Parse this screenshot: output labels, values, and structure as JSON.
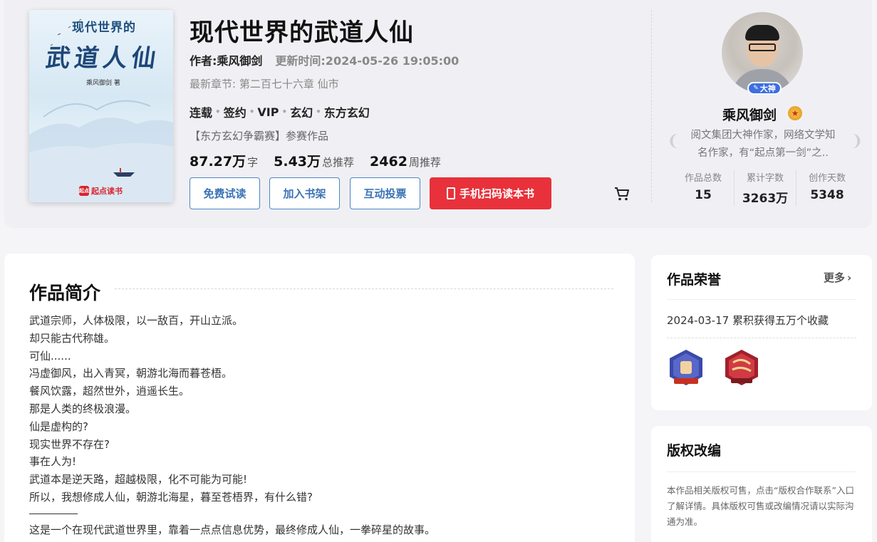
{
  "book": {
    "cover_subtitle": "现代世界的",
    "cover_main": "武道人仙",
    "cover_author": "乘风御剑 著",
    "cover_logo": "起点读书",
    "cover_logo_mark": "起点",
    "title": "现代世界的武道人仙",
    "author_label": "作者:乘风御剑",
    "update_label": "更新时间:2024-05-26 19:05:00",
    "latest_chapter": "最新章节: 第二百七十六章 仙市",
    "tags": [
      "连载",
      "签约",
      "VIP",
      "玄幻",
      "东方玄幻"
    ],
    "tag_separator": "•",
    "contest": "【东方玄幻争霸赛】参赛作品",
    "stats": [
      {
        "num": "87.27万",
        "unit": "字"
      },
      {
        "num": "5.43万",
        "unit": "总推荐"
      },
      {
        "num": "2462",
        "unit": "周推荐"
      }
    ]
  },
  "buttons": {
    "free_read": "免费试读",
    "add_shelf": "加入书架",
    "vote": "互动投票",
    "phone_read": "手机扫码读本书"
  },
  "author": {
    "name": "乘风御剑",
    "badge": "大神",
    "level_icon": "★",
    "desc_line1": "阅文集团大神作家，网络文学知",
    "desc_line2": "名作家，有“起点第一剑”之..",
    "laurel_left": "❨",
    "laurel_right": "❩",
    "stats": [
      {
        "label": "作品总数",
        "value": "15"
      },
      {
        "label": "累计字数",
        "value": "3263万"
      },
      {
        "label": "创作天数",
        "value": "5348"
      }
    ]
  },
  "intro": {
    "title": "作品简介",
    "lines": [
      "武道宗师，人体极限，以一敌百，开山立派。",
      "却只能古代称雄。",
      "可仙......",
      "冯虚御风，出入青冥，朝游北海而暮苍梧。",
      "餐风饮露，超然世外，逍遥长生。",
      "那是人类的终极浪漫。",
      "仙是虚构的?",
      "现实世界不存在?",
      "事在人为!",
      "武道本是逆天路，超越极限，化不可能为可能!",
      "所以，我想修成人仙，朝游北海星，暮至苍梧界，有什么错?"
    ],
    "final_line": "这是一个在现代武道世界里，靠着一点点信息优势，最终修成人仙，一拳碎星的故事。"
  },
  "honor": {
    "title": "作品荣誉",
    "more": "更多",
    "more_icon": "›",
    "item": "2024-03-17 累积获得五万个收藏"
  },
  "copyright": {
    "title": "版权改编",
    "text": "本作品相关版权可售，点击“版权合作联系”入口了解详情。具体版权可售或改编情况请以实际沟通为准。"
  },
  "colors": {
    "accent_red": "#e8313b",
    "accent_blue": "#3a73b5",
    "badge_blue": "#3d6fe0"
  }
}
